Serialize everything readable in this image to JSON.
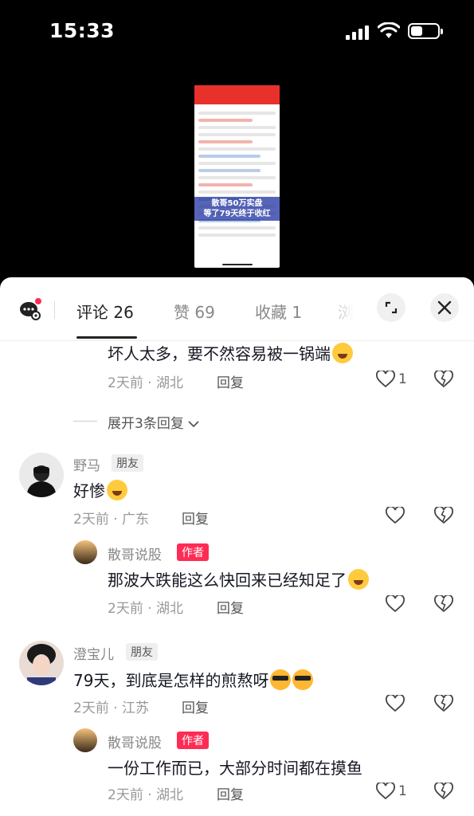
{
  "status_bar": {
    "time": "15:33"
  },
  "video": {
    "caption_line1": "散哥50万实盘",
    "caption_line2": "等了79天终于收红"
  },
  "tabs": [
    {
      "label": "评论 26"
    },
    {
      "label": "赞 69"
    },
    {
      "label": "收藏 1"
    },
    {
      "label": "浏览"
    }
  ],
  "comments": {
    "c1": {
      "text": "坏人太多，要不然容易被一锅端",
      "meta": "2天前 · 湖北",
      "reply": "回复",
      "likes": "1"
    },
    "expand": {
      "label": "展开3条回复"
    },
    "c2": {
      "name": "野马",
      "badge": "朋友",
      "text": "好惨",
      "meta": "2天前 · 广东",
      "reply": "回复"
    },
    "c2r": {
      "name": "散哥说股",
      "badge": "作者",
      "text": "那波大跌能这么快回来已经知足了",
      "meta": "2天前 · 湖北",
      "reply": "回复"
    },
    "c3": {
      "name": "澄宝儿",
      "badge": "朋友",
      "text": "79天，到底是怎样的煎熬呀",
      "meta": "2天前 · 江苏",
      "reply": "回复"
    },
    "c3r": {
      "name": "散哥说股",
      "badge": "作者",
      "text": "一份工作而已，大部分时间都在摸鱼",
      "meta": "2天前 · 湖北",
      "reply": "回复",
      "likes": "1"
    }
  }
}
